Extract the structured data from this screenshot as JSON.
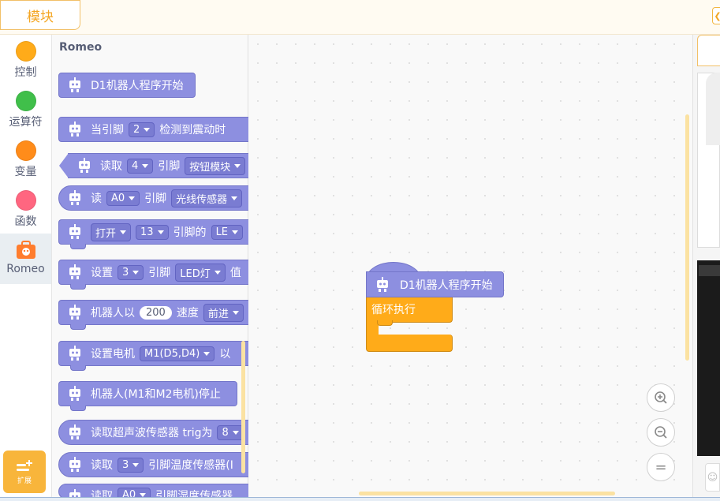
{
  "top": {
    "tab_label": "模块"
  },
  "categories": [
    {
      "label": "控制",
      "color": "#ffab19"
    },
    {
      "label": "运算符",
      "color": "#40bf4a"
    },
    {
      "label": "变量",
      "color": "#ff8c1a"
    },
    {
      "label": "函数",
      "color": "#ff6680"
    },
    {
      "label": "Romeo",
      "color": "#ff7d2e"
    }
  ],
  "extension": {
    "label": "扩展"
  },
  "palette": {
    "title": "Romeo",
    "blocks": [
      {
        "parts": [
          "D1机器人程序开始"
        ]
      },
      {
        "parts": [
          "当引脚",
          "2",
          "检测到震动时"
        ]
      },
      {
        "parts": [
          "读取",
          "4",
          "引脚",
          "按钮模块"
        ]
      },
      {
        "parts": [
          "读",
          "A0",
          "引脚",
          "光线传感器"
        ]
      },
      {
        "parts": [
          "打开",
          "13",
          "引脚的",
          "LE"
        ]
      },
      {
        "parts": [
          "设置",
          "3",
          "引脚",
          "LED灯",
          "值"
        ]
      },
      {
        "parts": [
          "机器人以",
          "200",
          "速度",
          "前进"
        ]
      },
      {
        "parts": [
          "设置电机",
          "M1(D5,D4)",
          "以"
        ]
      },
      {
        "parts": [
          "机器人(M1和M2电机)停止"
        ]
      },
      {
        "parts": [
          "读取超声波传感器 trig为",
          "8"
        ]
      },
      {
        "parts": [
          "读取",
          "3",
          "引脚温度传感器(I"
        ]
      },
      {
        "parts": [
          "读取",
          "A0",
          "引脚湿度传感器"
        ]
      }
    ]
  },
  "workspace": {
    "hat_label": "D1机器人程序开始",
    "loop_label": "循环执行",
    "zoom_in": "+",
    "zoom_out": "−",
    "zoom_reset": "="
  },
  "colors": {
    "romeo_block": "#8d8fe0",
    "control_block": "#ffab19",
    "accent": "#f4a623"
  }
}
